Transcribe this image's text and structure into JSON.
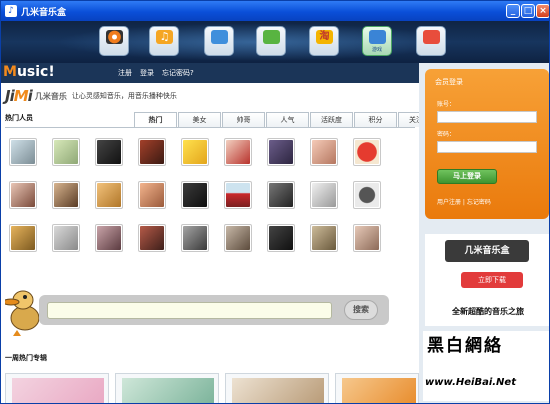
{
  "window": {
    "title": "几米音乐盒",
    "min": "_",
    "max": "□",
    "close": "×"
  },
  "toolbar": {
    "items": [
      {
        "label": "",
        "color": "#f07c1c"
      },
      {
        "label": "",
        "color": "#f5a623"
      },
      {
        "label": "",
        "color": "#3f8fdc"
      },
      {
        "label": "",
        "color": "#58b441"
      },
      {
        "label": "",
        "color": "#f4b400"
      },
      {
        "label": "游戏",
        "color": "#4ca664"
      },
      {
        "label": "",
        "color": "#e84d3c"
      }
    ]
  },
  "nav": {
    "logo": "Music!",
    "links": [
      "注册",
      "登录",
      "忘记密码?"
    ]
  },
  "brand": {
    "logo": "JiMi",
    "cn": "几米音乐",
    "tagline": "让心灵感知音乐，用音乐播种快乐"
  },
  "section_title": "热门人员",
  "tabs": [
    "热门",
    "美女",
    "帅哥",
    "人气",
    "活跃度",
    "积分",
    "关注度"
  ],
  "active_tab": "热门",
  "search": {
    "value": "",
    "button": "搜索"
  },
  "weekly_title": "一周热门专辑",
  "login": {
    "header": "会员登录",
    "account_label": "账号：",
    "password_label": "密码：",
    "submit": "马上登录",
    "links": "用户注册 | 忘记密码"
  },
  "ad": {
    "title": "几米音乐盒",
    "download": "立即下载",
    "slogan": "全新超酷的音乐之旅"
  },
  "watermark": {
    "line1": "黑白網絡",
    "line2": "www.HeiBai.Net"
  }
}
